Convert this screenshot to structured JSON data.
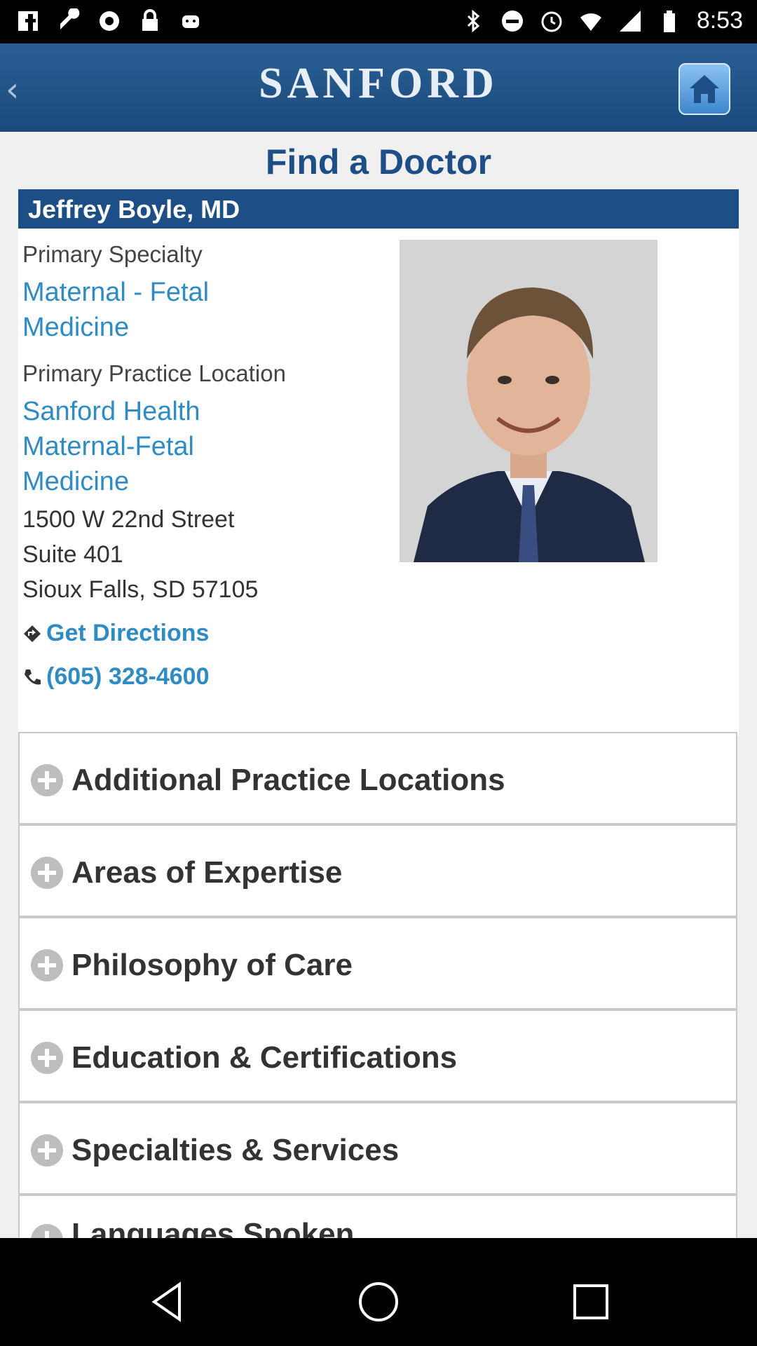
{
  "status_bar": {
    "time": "8:53",
    "left_icons": [
      "facebook-icon",
      "wrench-icon",
      "app-icon",
      "lock-icon",
      "android-icon"
    ],
    "right_icons": [
      "bluetooth-icon",
      "do-not-disturb-icon",
      "alarm-icon",
      "wifi-icon",
      "cell-signal-icon",
      "battery-icon"
    ]
  },
  "header": {
    "logo": "SANFORD",
    "back_icon": "chevron-left-icon",
    "home_icon": "home-icon"
  },
  "page": {
    "title": "Find a Doctor"
  },
  "doctor": {
    "name": "Jeffrey Boyle, MD",
    "primary_specialty_label": "Primary Specialty",
    "primary_specialty_line1": "Maternal - Fetal",
    "primary_specialty_line2": "Medicine",
    "primary_location_label": "Primary Practice Location",
    "location_line1": "Sanford Health",
    "location_line2": "Maternal-Fetal",
    "location_line3": "Medicine",
    "address_line1": "1500 W 22nd Street",
    "address_line2": "Suite 401",
    "address_line3": "Sioux Falls, SD 57105",
    "directions_label": "Get Directions",
    "phone": "(605) 328-4600"
  },
  "sections": [
    {
      "label": "Additional Practice Locations"
    },
    {
      "label": "Areas of Expertise"
    },
    {
      "label": "Philosophy of Care"
    },
    {
      "label": "Education & Certifications"
    },
    {
      "label": "Specialties & Services"
    },
    {
      "label": "Languages Spoken"
    }
  ],
  "colors": {
    "header_blue": "#1d4f86",
    "link_blue": "#2e8bc4"
  }
}
